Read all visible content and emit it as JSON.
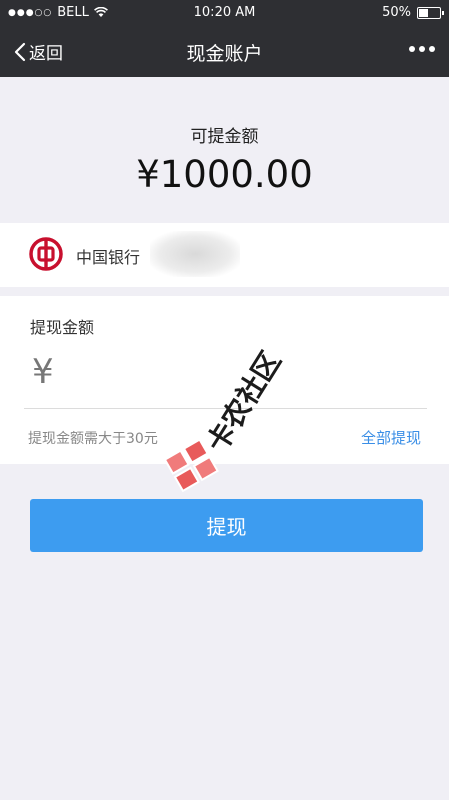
{
  "status_bar": {
    "carrier": "BELL",
    "time": "10:20 AM",
    "battery": "50%",
    "battery_level": 0.5
  },
  "nav": {
    "back_label": "返回",
    "title": "现金账户"
  },
  "balance": {
    "label": "可提金额",
    "amount": "¥1000.00"
  },
  "bank": {
    "name": "中国银行"
  },
  "withdraw": {
    "label": "提现金额",
    "currency": "¥",
    "input_value": "",
    "hint": "提现金额需大于30元",
    "all_link": "全部提现"
  },
  "submit_label": "提现",
  "watermark": "卡农社区",
  "colors": {
    "nav_bg": "#2e2f33",
    "page_bg": "#f0eff5",
    "accent": "#3d9cf0",
    "link": "#3a8ee6",
    "bank_red": "#c8102e"
  }
}
